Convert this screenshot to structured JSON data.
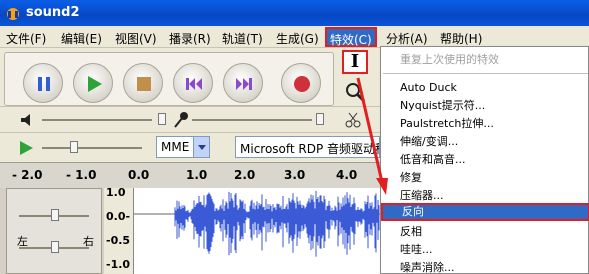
{
  "window": {
    "title": "sound2"
  },
  "menubar": [
    "文件(F)",
    "编辑(E)",
    "视图(V)",
    "播录(R)",
    "轨道(T)",
    "生成(G)",
    "特效(C)",
    "分析(A)",
    "帮助(H)"
  ],
  "transport": {
    "pause_icon": "pause-icon",
    "play_icon": "play-icon",
    "stop_icon": "stop-icon",
    "skip_start_icon": "skip-start-icon",
    "skip_end_icon": "skip-end-icon",
    "record_icon": "record-icon"
  },
  "tools": {
    "cursor_label": "I"
  },
  "device": {
    "host": "MME",
    "output": "Microsoft RDP 音频驱动程"
  },
  "ruler": {
    "ticks": [
      "- 2.0",
      "- 1.0",
      "0.0",
      "1.0",
      "2.0",
      "3.0",
      "4.0"
    ]
  },
  "track": {
    "scale": [
      "1.0",
      "0.0-",
      "-0.5",
      "-1.0"
    ],
    "pan_left": "左",
    "pan_right": "右"
  },
  "dropdown": {
    "items": [
      {
        "label": "重复上次使用的特效",
        "disabled": true
      },
      {
        "label": "Auto Duck"
      },
      {
        "label": "Nyquist提示符..."
      },
      {
        "label": "Paulstretch拉伸..."
      },
      {
        "label": "伸缩/变调..."
      },
      {
        "label": "低音和高音..."
      },
      {
        "label": "修复"
      },
      {
        "label": "压缩器..."
      },
      {
        "label": "反向",
        "highlighted": true
      },
      {
        "label": "反相"
      },
      {
        "label": "哇哇..."
      },
      {
        "label": "噪声消除..."
      }
    ]
  },
  "colors": {
    "highlight": "#316ac5",
    "annotation": "#e02020",
    "waveform": "#3a5ad6"
  }
}
